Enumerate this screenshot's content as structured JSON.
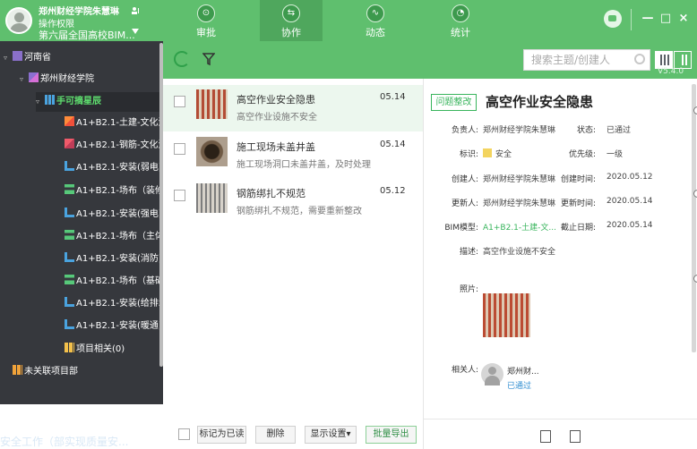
{
  "header": {
    "user_name": "郑州财经学院朱慧琳",
    "user_role": "操作权限",
    "project_name": "第六届全国高校BIM...",
    "tabs": [
      {
        "label": "审批",
        "icon": "approval-icon",
        "glyph": "⊙"
      },
      {
        "label": "协作",
        "icon": "collaboration-icon",
        "glyph": "⇆"
      },
      {
        "label": "动态",
        "icon": "activity-icon",
        "glyph": "∿"
      },
      {
        "label": "统计",
        "icon": "statistics-icon",
        "glyph": "◔"
      }
    ],
    "window_controls": {
      "minimize": "—",
      "maximize": "□",
      "close": "×"
    }
  },
  "sidebar": {
    "rows": [
      {
        "label": "河南省",
        "expander": "▿",
        "icon": "province-icon"
      },
      {
        "label": "郑州财经学院",
        "expander": "▿",
        "icon": "school-icon"
      },
      {
        "label": "手可摘星辰",
        "expander": "▿",
        "icon": "project-icon"
      },
      {
        "label": "A1+B2.1-土建-文化活动",
        "expander": "",
        "icon": "civil-model-icon"
      },
      {
        "label": "A1+B2.1-钢筋-文化活动",
        "expander": "",
        "icon": "steel-model-icon"
      },
      {
        "label": "A1+B2.1-安装(弱电)-文",
        "expander": "",
        "icon": "installation-model-icon"
      },
      {
        "label": "A1+B2.1-场布（装修阶",
        "expander": "",
        "icon": "site-layout-model-icon"
      },
      {
        "label": "A1+B2.1-安装(强电)-文",
        "expander": "",
        "icon": "installation-model-icon"
      },
      {
        "label": "A1+B2.1-场布（主体阶",
        "expander": "",
        "icon": "site-layout-model-icon"
      },
      {
        "label": "A1+B2.1-安装(消防)-文",
        "expander": "",
        "icon": "installation-model-icon"
      },
      {
        "label": "A1+B2.1-场布（基础阶",
        "expander": "",
        "icon": "site-layout-model-icon"
      },
      {
        "label": "A1+B2.1-安装(给排水)",
        "expander": "",
        "icon": "installation-model-icon"
      },
      {
        "label": "A1+B2.1-安装(暖通)-文",
        "expander": "",
        "icon": "installation-model-icon"
      },
      {
        "label": "项目相关(0)",
        "expander": "",
        "icon": "project-related-icon"
      },
      {
        "label": "未关联项目部",
        "expander": "",
        "icon": "unlinked-project-icon"
      }
    ]
  },
  "toolbar": {
    "search_placeholder": "搜索主题/创建人",
    "version": "V5.4.0"
  },
  "issues": [
    {
      "title": "高空作业安全隐患",
      "description": "高空作业设施不安全",
      "date": "05.14",
      "thumbnail": "red-scaffold-thumbnail"
    },
    {
      "title": "施工现场未盖井盖",
      "description": "施工现场洞口未盖井盖，及时处理",
      "date": "05.14",
      "thumbnail": "manhole-thumbnail"
    },
    {
      "title": "钢筋绑扎不规范",
      "description": "钢筋绑扎不规范，需要重新整改",
      "date": "05.12",
      "thumbnail": "steel-binding-thumbnail"
    }
  ],
  "detail": {
    "status_tag": "问题整改",
    "title": "高空作业安全隐患",
    "labels": {
      "owner": "负责人:",
      "state": "状态:",
      "mark": "标识:",
      "priority": "优先级:",
      "creator": "创建人:",
      "created_time": "创建时间:",
      "updater": "更新人:",
      "updated_time": "更新时间:",
      "bim_model": "BIM模型:",
      "deadline": "截止日期:",
      "description": "描述:",
      "photo": "照片:",
      "related": "相关人:"
    },
    "values": {
      "owner": "郑州财经学院朱慧琳",
      "state": "已通过",
      "mark": "安全",
      "priority": "一级",
      "creator": "郑州财经学院朱慧琳",
      "created_time": "2020.05.12",
      "updater": "郑州财经学院朱慧琳",
      "updated_time": "2020.05.14",
      "bim_model": "A1+B2.1-土建-文...",
      "deadline": "2020.05.14",
      "description": "高空作业设施不安全",
      "related_name": "郑州财...",
      "related_status": "已通过"
    },
    "collapse_glyph": "《"
  },
  "footer": {
    "mark_read": "标记为已读",
    "delete": "删除",
    "display_settings": "显示设置",
    "batch_export": "批量导出",
    "display_settings_caret": "▾",
    "faint_text": "安全工作（部实现质量安..."
  },
  "colors": {
    "header_green": "#5fbf6e",
    "sidebar_dark": "#36383d",
    "accent_green": "#38b45c"
  }
}
